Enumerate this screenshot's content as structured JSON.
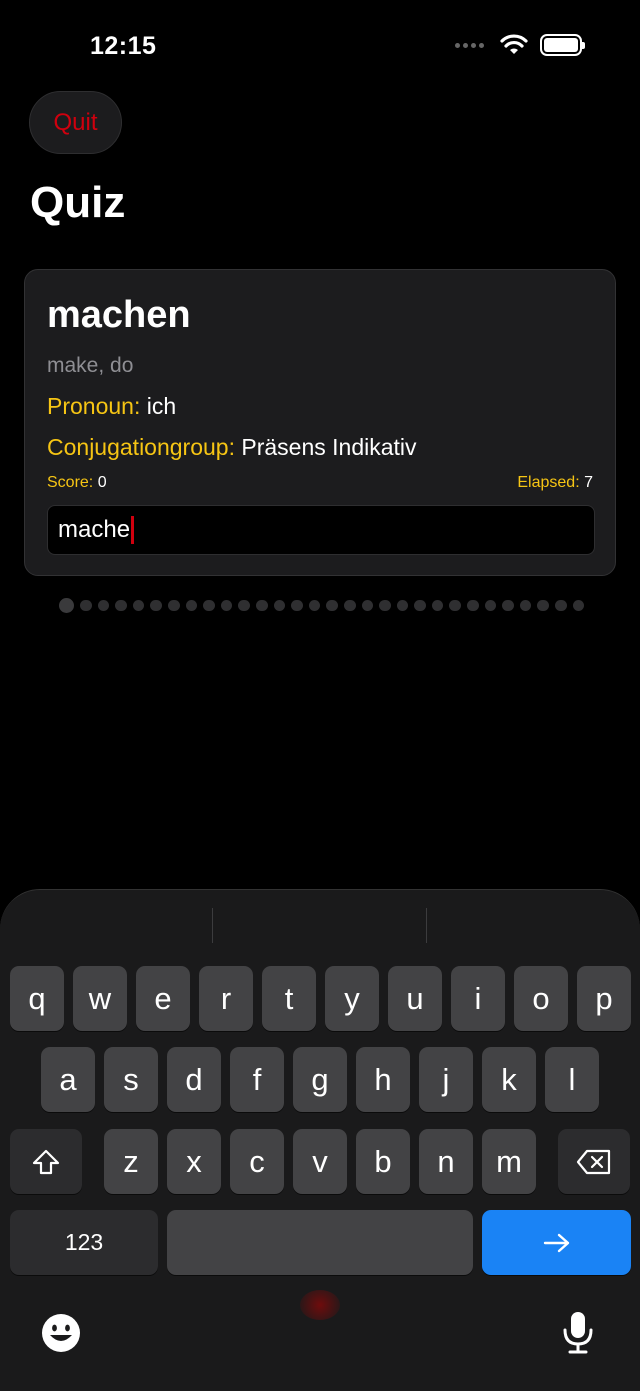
{
  "status_bar": {
    "time": "12:15"
  },
  "toolbar": {
    "quit_label": "Quit"
  },
  "page": {
    "title": "Quiz"
  },
  "card": {
    "verb": "machen",
    "translation": "make, do",
    "pronoun_label": "Pronoun:",
    "pronoun_value": "ich",
    "group_label": "Conjugationgroup:",
    "group_value": "Präsens Indikativ",
    "score_label": "Score:",
    "score_value": "0",
    "elapsed_label": "Elapsed:",
    "elapsed_value": "7",
    "answer_value": "mache"
  },
  "progress": {
    "total": 30,
    "current": 1
  },
  "keyboard": {
    "row1": [
      "q",
      "w",
      "e",
      "r",
      "t",
      "y",
      "u",
      "i",
      "o",
      "p"
    ],
    "row2": [
      "a",
      "s",
      "d",
      "f",
      "g",
      "h",
      "j",
      "k",
      "l"
    ],
    "row3": [
      "z",
      "x",
      "c",
      "v",
      "b",
      "n",
      "m"
    ],
    "numbers_label": "123",
    "return_icon": "arrow-right-icon",
    "shift_icon": "shift-icon",
    "delete_icon": "delete-icon",
    "emoji_icon": "emoji-icon",
    "mic_icon": "microphone-icon"
  },
  "colors": {
    "accent_red": "#d0000e",
    "label_yellow": "#f6c514",
    "return_blue": "#1a83f5",
    "card_bg": "#1c1c1e"
  }
}
